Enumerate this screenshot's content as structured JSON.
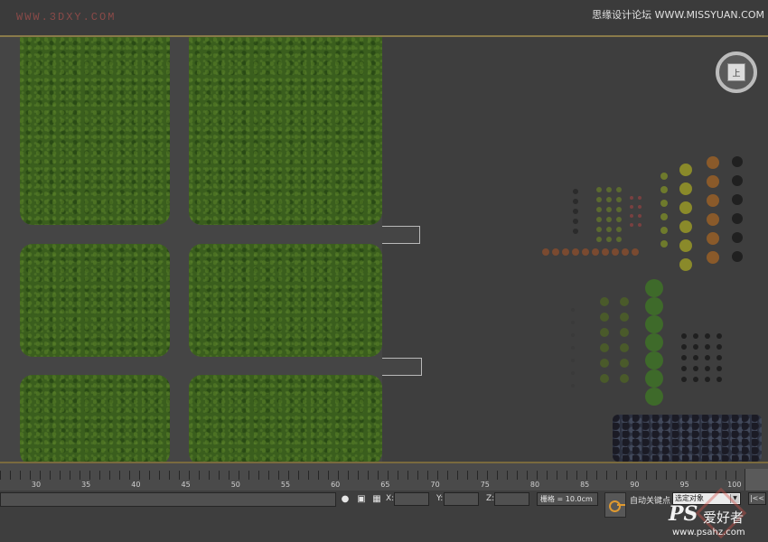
{
  "watermarks": {
    "left": "WWW.3DXY.COM",
    "right": "思缘设计论坛 WWW.MISSYUAN.COM"
  },
  "viewport": {
    "nav_cube_label": "上"
  },
  "timeline": {
    "ticks": [
      "30",
      "35",
      "40",
      "45",
      "50",
      "55",
      "60",
      "65",
      "70",
      "75",
      "80",
      "85",
      "90",
      "95",
      "100"
    ]
  },
  "status": {
    "icons": {
      "lock": "lock-icon",
      "selection_lock": "padlock-icon",
      "absolute_mode": "transform-mode-icon"
    },
    "coord_x_label": "X:",
    "coord_y_label": "Y:",
    "coord_z_label": "Z:",
    "coord_x_value": "",
    "coord_y_value": "",
    "coord_z_value": "",
    "grid": "栅格 = 10.0cm",
    "auto_key": "自动关键点",
    "selection_set": "选定对象",
    "prev_frame": "|<<"
  },
  "logo": {
    "main": "PS",
    "cn": "爱好者",
    "url": "www.psahz.com"
  },
  "colors": {
    "viewport_bg": "#3e3e3e",
    "grass": "#3a5e1d",
    "road": "#454545",
    "accent_frame": "#8a7a4a",
    "key_accent": "#e09a30"
  }
}
